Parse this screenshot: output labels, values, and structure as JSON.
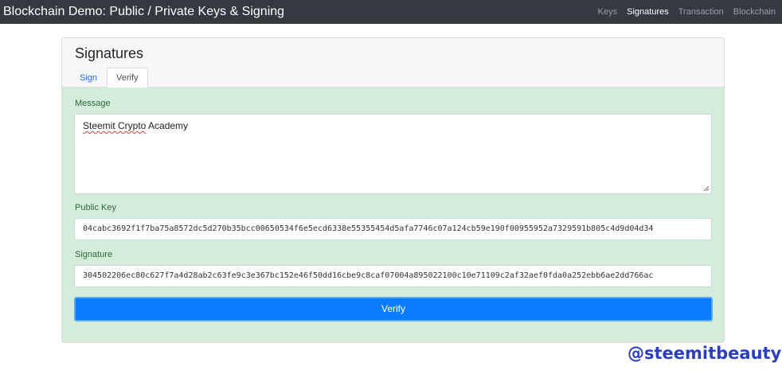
{
  "navbar": {
    "brand": "Blockchain Demo: Public / Private Keys & Signing",
    "links": [
      {
        "label": "Keys",
        "active": false
      },
      {
        "label": "Signatures",
        "active": true
      },
      {
        "label": "Transaction",
        "active": false
      },
      {
        "label": "Blockchain",
        "active": false
      }
    ]
  },
  "card": {
    "title": "Signatures",
    "tabs": [
      {
        "label": "Sign",
        "active": false
      },
      {
        "label": "Verify",
        "active": true
      }
    ],
    "message": {
      "label": "Message",
      "value_part1": "Steemit Crypto",
      "value_part2": " Academy"
    },
    "public_key": {
      "label": "Public Key",
      "value": "04cabc3692f1f7ba75a8572dc5d270b35bcc00650534f6e5ecd6338e55355454d5afa7746c07a124cb59e190f00955952a7329591b805c4d9d04d34"
    },
    "signature": {
      "label": "Signature",
      "value": "304502206ec80c627f7a4d28ab2c63fe9c3e367bc152e46f50dd16cbe9c8caf07004a895022100c10e71109c2af32aef0fda0a252ebb6ae2dd766ac"
    },
    "verify_button": "Verify"
  },
  "watermark": "@steemitbeauty",
  "colors": {
    "navbar_bg": "#343a40",
    "card_body_bg": "#d4ecda",
    "primary": "#0a7cff",
    "watermark": "#2b3fb8"
  }
}
